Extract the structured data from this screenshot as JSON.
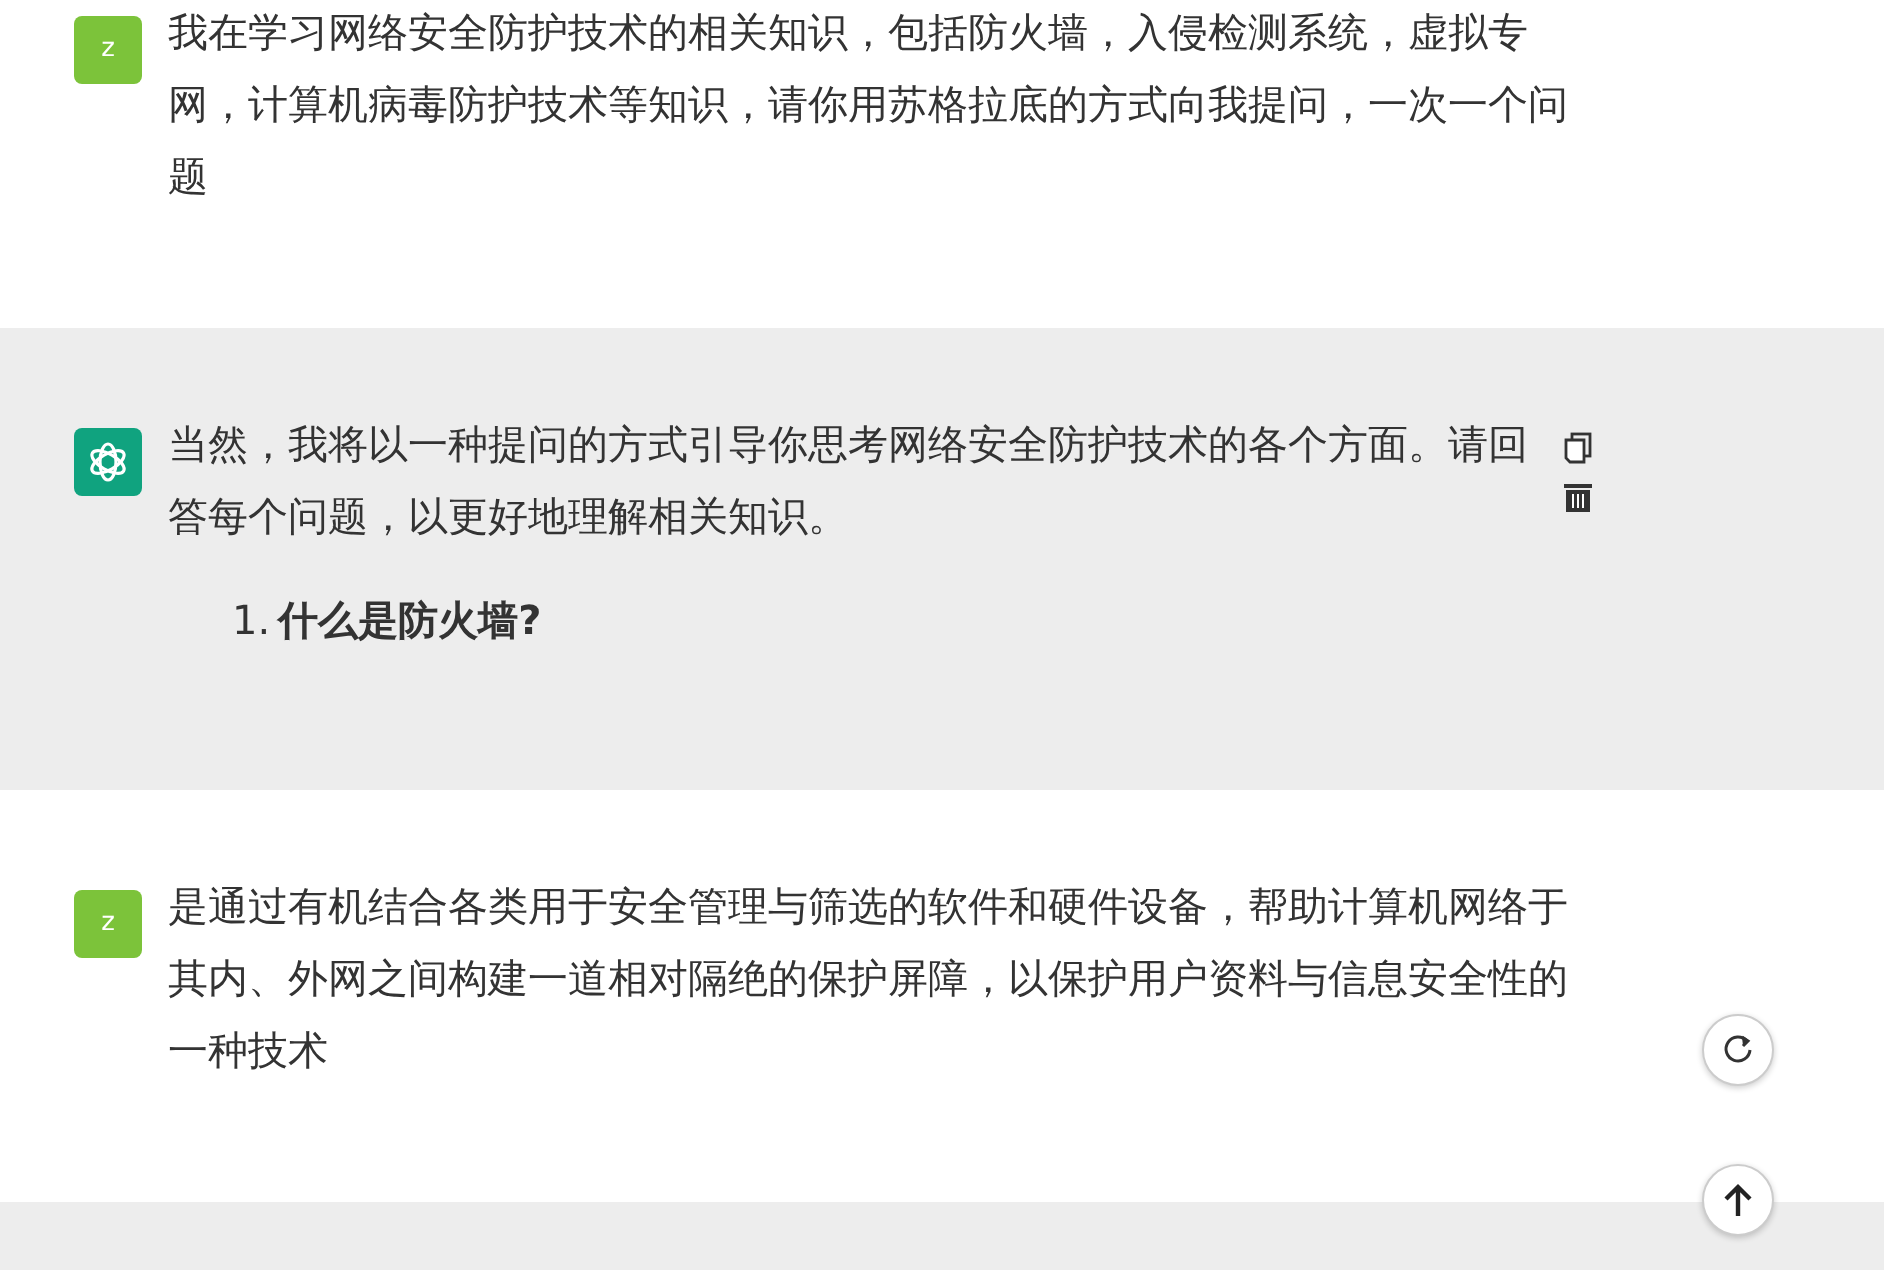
{
  "messages": [
    {
      "kind": "user",
      "avatar": "z",
      "text": "我在学习网络安全防护技术的相关知识，包括防火墙，入侵检测系统，虚拟专网，计算机病毒防护技术等知识，请你用苏格拉底的方式向我提问，一次一个问题"
    },
    {
      "kind": "assistant",
      "text": "当然，我将以一种提问的方式引导你思考网络安全防护技术的各个方面。请回答每个问题，以更好地理解相关知识。",
      "list": [
        {
          "number": "1.",
          "text": "什么是防火墙?"
        }
      ]
    },
    {
      "kind": "user",
      "avatar": "z",
      "text": "是通过有机结合各类用于安全管理与筛选的软件和硬件设备，帮助计算机网络于其内、外网之间构建一道相对隔绝的保护屏障，以保护用户资料与信息安全性的一种技术"
    },
    {
      "kind": "assistant"
    }
  ]
}
